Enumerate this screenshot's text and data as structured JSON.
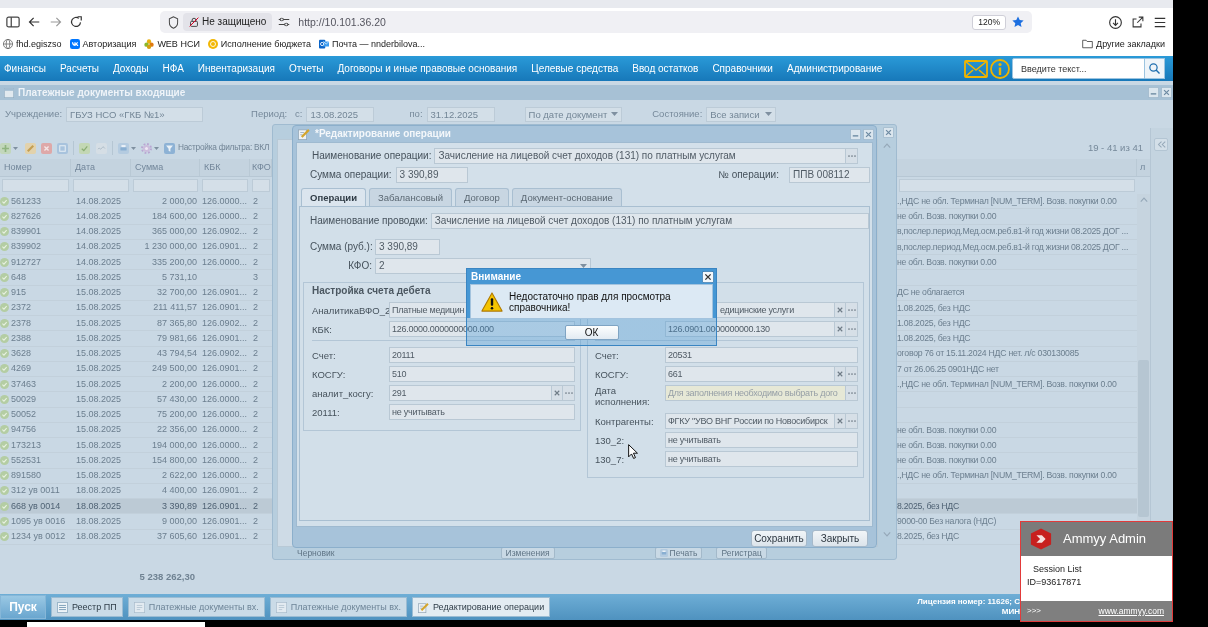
{
  "browser": {
    "security_label": "Не защищено",
    "url": "http://10.101.36.20",
    "zoom": "120%"
  },
  "bookmarks": {
    "items": [
      {
        "label": "fhd.egiszso",
        "kind": "globe"
      },
      {
        "label": "Авторизация",
        "kind": "tile"
      },
      {
        "label": "WEB НСИ",
        "kind": "flower"
      },
      {
        "label": "Исполнение бюджета",
        "kind": "coin"
      },
      {
        "label": "Почта — nnderbilova...",
        "kind": "mail"
      }
    ],
    "other": "Другие закладки"
  },
  "app_menu": {
    "items": [
      "Финансы",
      "Расчеты",
      "Доходы",
      "НФА",
      "Инвентаризация",
      "Отчеты",
      "Договоры и иные правовые основания",
      "Целевые средства",
      "Ввод остатков",
      "Справочники",
      "Администрирование"
    ],
    "search": {
      "placeholder": "Введите текст..."
    }
  },
  "registry": {
    "title": "Платежные документы входящие",
    "institution": {
      "label": "Учреждение:",
      "value": "ГБУЗ НСО «ГКБ №1»"
    },
    "period": {
      "label": "Период:",
      "from_label": "с:",
      "from": "13.08.2025",
      "to_label": "по:",
      "to": "31.12.2025"
    },
    "date_mode": "По дате документ",
    "state": {
      "label": "Состояние:",
      "value": "Все записи"
    },
    "filter_setting": "Настройка фильтра: ВКЛ",
    "pager": "19 - 41 из 41",
    "columns": [
      "Номер",
      "Дата",
      "Сумма",
      "КБК",
      "КФО"
    ],
    "column_7": "л",
    "rows": [
      {
        "number": "561233",
        "date": "14.08.2025",
        "sum": "2 000,00",
        "kbk": "126.0000...",
        "kfo": "2",
        "description": ".,НДС не обл. Терминал [NUM_TERM]. Возв. покупки 0.00",
        "selected": false
      },
      {
        "number": "827626",
        "date": "14.08.2025",
        "sum": "184 600,00",
        "kbk": "126.0000...",
        "kfo": "2",
        "description": "не обл. Возв. покупки 0.00",
        "selected": false
      },
      {
        "number": "839901",
        "date": "14.08.2025",
        "sum": "365 000,00",
        "kbk": "126.0902...",
        "kfo": "2",
        "description": "в,послер.период.Мед.осм.реб.в1-й год жизни 08.2025 ДОГ ...",
        "selected": false
      },
      {
        "number": "839902",
        "date": "14.08.2025",
        "sum": "1 230 000,00",
        "kbk": "126.0901...",
        "kfo": "2",
        "description": "в,послер.период.Мед.осм.реб.в1-й год жизни 08.2025 ДОГ ...",
        "selected": false
      },
      {
        "number": "912727",
        "date": "14.08.2025",
        "sum": "335 200,00",
        "kbk": "126.0000...",
        "kfo": "2",
        "description": "не обл. Возв. покупки 0.00",
        "selected": false
      },
      {
        "number": "648",
        "date": "15.08.2025",
        "sum": "5 731,10",
        "kfo": "3",
        "selected": false
      },
      {
        "number": "915",
        "date": "15.08.2025",
        "sum": "32 700,00",
        "kbk": "126.0901...",
        "kfo": "2",
        "description": "ДС не облагается",
        "selected": false
      },
      {
        "number": "2372",
        "date": "15.08.2025",
        "sum": "211 411,57",
        "kbk": "126.0901...",
        "kfo": "2",
        "description": "1.08.2025, без НДС",
        "selected": false
      },
      {
        "number": "2378",
        "date": "15.08.2025",
        "sum": "87 365,80",
        "kbk": "126.0902...",
        "kfo": "2",
        "description": "1.08.2025, без НДС",
        "selected": false
      },
      {
        "number": "2388",
        "date": "15.08.2025",
        "sum": "79 981,66",
        "kbk": "126.0901...",
        "kfo": "2",
        "description": "1.08.2025, без НДС",
        "selected": false
      },
      {
        "number": "3628",
        "date": "15.08.2025",
        "sum": "43 794,54",
        "kbk": "126.0902...",
        "kfo": "2",
        "description": "оговор 76 от 15.11.2024 НДС нет. л/с 030130085",
        "selected": false
      },
      {
        "number": "4269",
        "date": "15.08.2025",
        "sum": "249 500,00",
        "kbk": "126.0901...",
        "kfo": "2",
        "description": "7 от 26.06.25 0901НДС нет",
        "selected": false
      },
      {
        "number": "37463",
        "date": "15.08.2025",
        "sum": "2 200,00",
        "kbk": "126.0000...",
        "kfo": "2",
        "description": ".,НДС не обл. Терминал [NUM_TERM]. Возв. покупки 0.00",
        "selected": false
      },
      {
        "number": "50029",
        "date": "15.08.2025",
        "sum": "57 430,00",
        "kbk": "126.0000...",
        "kfo": "2",
        "selected": false
      },
      {
        "number": "50052",
        "date": "15.08.2025",
        "sum": "75 200,00",
        "kbk": "126.0000...",
        "kfo": "2",
        "selected": false
      },
      {
        "number": "94756",
        "date": "15.08.2025",
        "sum": "22 356,00",
        "kbk": "126.0000...",
        "kfo": "2",
        "description": "не обл. Возв. покупки 0.00",
        "selected": false
      },
      {
        "number": "173213",
        "date": "15.08.2025",
        "sum": "194 000,00",
        "kbk": "126.0000...",
        "kfo": "2",
        "description": "не обл. Возв. покупки 0.00",
        "selected": false
      },
      {
        "number": "552531",
        "date": "15.08.2025",
        "sum": "154 800,00",
        "kbk": "126.0000...",
        "kfo": "2",
        "description": "не обл. Возв. покупки 0.00",
        "selected": false
      },
      {
        "number": "891580",
        "date": "15.08.2025",
        "sum": "2 622,00",
        "kbk": "126.0000...",
        "kfo": "2",
        "description": ".,НДС не обл. Терминал [NUM_TERM]. Возв. покупки 0.00",
        "selected": false
      },
      {
        "number": "312 ув 0011",
        "date": "18.08.2025",
        "sum": "4 400,00",
        "kbk": "126.0901...",
        "kfo": "2",
        "selected": false
      },
      {
        "number": "668 ув 0014",
        "date": "18.08.2025",
        "sum": "3 390,89",
        "kbk": "126.0901...",
        "kfo": "2",
        "description": "8.2025, без НДС",
        "selected": true
      },
      {
        "number": "1095 ув 0016",
        "date": "18.08.2025",
        "sum": "9 000,00",
        "kbk": "126.0901...",
        "kfo": "2",
        "description": "9000-00 Без налога (НДС)",
        "selected": false
      },
      {
        "number": "1234 ув 0012",
        "date": "18.08.2025",
        "sum": "37 605,60",
        "kbk": "126.0901...",
        "kfo": "2",
        "description": "8.2025, без НДС",
        "selected": false
      }
    ],
    "total": "5 238 262,30"
  },
  "payment_window": {
    "footer": [
      {
        "kind": "label",
        "label": "Черновик"
      },
      {
        "kind": "button",
        "label": "Изменения"
      },
      {
        "kind": "print",
        "label": "Печать"
      },
      {
        "kind": "button",
        "label": "Регистрац"
      }
    ]
  },
  "dialog": {
    "title": "*Редактирование операции",
    "operation_name": {
      "label": "Наименование операции:",
      "value": "Зачисление на лицевой счет доходов (131) по платным услугам"
    },
    "operation_sum": {
      "label": "Сумма операции:",
      "value": "3 390,89"
    },
    "operation_number": {
      "label": "№ операции:",
      "value": "ППВ 008112"
    },
    "tabs": [
      {
        "label": "Операции",
        "selected": true
      },
      {
        "label": "Забалансовый",
        "selected": false
      },
      {
        "label": "Договор",
        "selected": false
      },
      {
        "label": "Документ-основание",
        "selected": false
      }
    ],
    "entry_name": {
      "label": "Наименование проводки:",
      "value": "Зачисление на лицевой счет доходов (131) по платным услугам"
    },
    "entry_sum": {
      "label": "Сумма (руб.):",
      "value": "3 390,89"
    },
    "kfo": {
      "label": "КФО:",
      "value": "2"
    },
    "debit": {
      "title": "Настройка счета дебета",
      "groups": [
        [
          {
            "label": "АналитикаВФО_2",
            "value": "Платные медицин",
            "kind": "plain"
          },
          {
            "label": "КБК:",
            "value": "126.0000.0000000000.000",
            "kind": "plain"
          }
        ],
        [
          {
            "label": "Счет:",
            "value": "20111",
            "kind": "plain"
          },
          {
            "label": "КОСГУ:",
            "value": "510",
            "kind": "plain"
          },
          {
            "label": "аналит_косгу:",
            "value": "291",
            "kind": "lookup"
          },
          {
            "label": "20111:",
            "value": "не учитывать",
            "kind": "plain"
          }
        ]
      ]
    },
    "credit": {
      "groups": [
        [
          {
            "value": "едицинские услуги",
            "kind": "lookup"
          },
          {
            "value": "126.0901.0000000000.130",
            "kind": "lookup"
          }
        ],
        [
          {
            "label": "Счет:",
            "value": "20531",
            "kind": "plain"
          },
          {
            "label": "КОСГУ:",
            "value": "661",
            "kind": "lookup"
          },
          {
            "label": "Дата исполнения:",
            "placeholder": "Для заполнения необходимо выбрать дого",
            "kind": "picker"
          },
          {
            "label": "Контрагенты:",
            "value": "ФГКУ \"УВО ВНГ России по Новосибирск",
            "kind": "lookup"
          },
          {
            "label": "130_2:",
            "value": "не учитывать",
            "kind": "plain"
          },
          {
            "label": "130_7:",
            "value": "не учитывать",
            "kind": "plain"
          }
        ]
      ]
    },
    "buttons": [
      "Сохранить",
      "Закрыть"
    ]
  },
  "alert": {
    "title": "Внимание",
    "message": "Недостаточно прав для просмотра справочника!",
    "button": "ОК"
  },
  "taskbar": {
    "start": "Пуск",
    "items": [
      {
        "label": "Реестр ПП",
        "kind": "list",
        "selected": false,
        "disabled": false
      },
      {
        "label": "Платежные документы вх.",
        "kind": "doc",
        "selected": false,
        "disabled": true
      },
      {
        "label": "Платежные документы вх.",
        "kind": "doc",
        "selected": false,
        "disabled": true
      },
      {
        "label": "Редактирование операции",
        "kind": "edit",
        "selected": true,
        "disabled": false
      }
    ],
    "license": [
      "Лицензия номер: 11626; С",
      "МИН"
    ]
  },
  "ammyy": {
    "title": "Ammyy Admin",
    "session_list": "Session List",
    "id": "ID=93617871",
    "more": ">>>",
    "link": "www.ammyy.com"
  }
}
